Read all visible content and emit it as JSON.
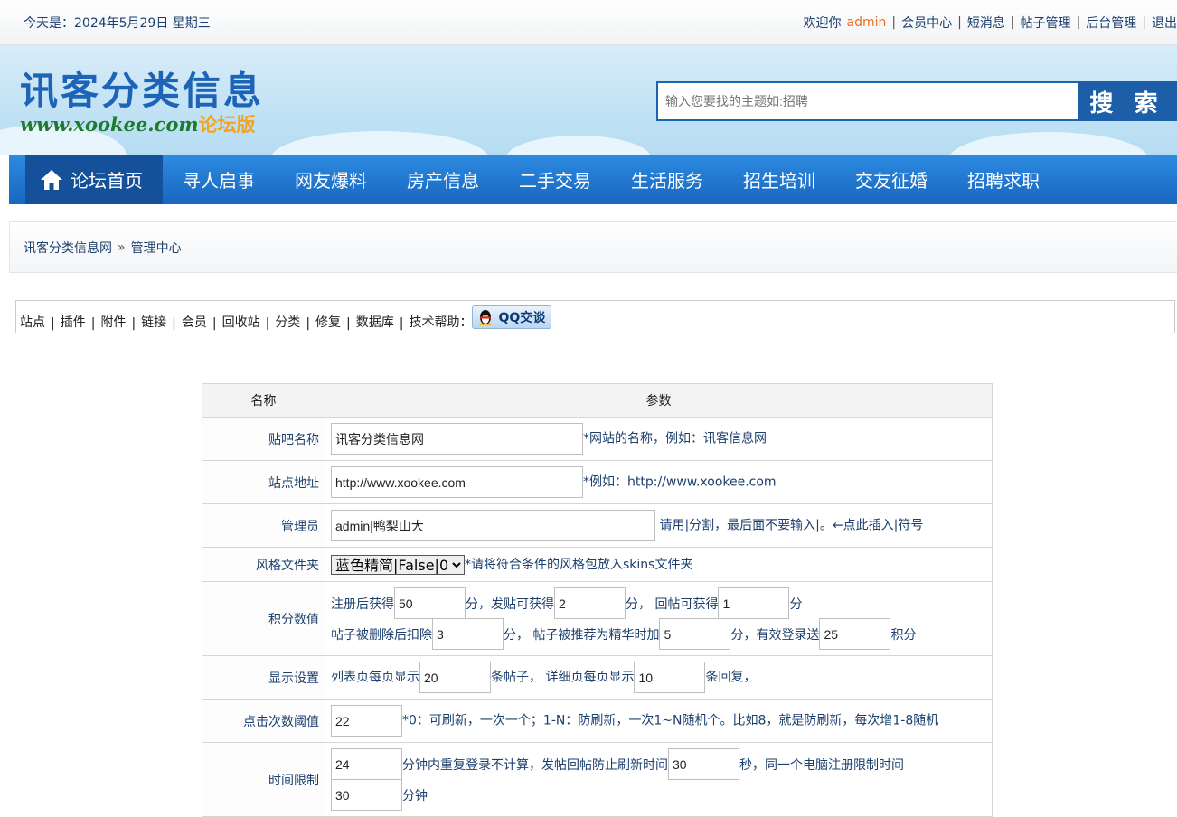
{
  "topbar": {
    "date_text": "今天是：2024年5月29日 星期三",
    "welcome": "欢迎你",
    "username": "admin",
    "links": [
      "会员中心",
      "短消息",
      "帖子管理",
      "后台管理",
      "退出"
    ]
  },
  "header": {
    "logo_cn": "讯客分类信息",
    "logo_en": "www.xookee.com",
    "logo_version": "论坛版",
    "search_placeholder": "输入您要找的主题如:招聘",
    "search_button": "搜 索"
  },
  "nav": {
    "items": [
      "论坛首页",
      "寻人启事",
      "网友爆料",
      "房产信息",
      "二手交易",
      "生活服务",
      "招生培训",
      "交友征婚",
      "招聘求职"
    ]
  },
  "breadcrumb": {
    "home": "讯客分类信息网",
    "arrow": "»",
    "current": "管理中心"
  },
  "admin_menu": {
    "items": [
      "站点",
      "插件",
      "附件",
      "链接",
      "会员",
      "回收站",
      "分类",
      "修复",
      "数据库"
    ],
    "help": "技术帮助：",
    "qq_label": "QQ交谈"
  },
  "form": {
    "col_name": "名称",
    "col_param": "参数",
    "site_name": {
      "label": "贴吧名称",
      "value": "讯客分类信息网",
      "hint": "*网站的名称，例如：讯客信息网"
    },
    "site_url": {
      "label": "站点地址",
      "value": "http://www.xookee.com",
      "hint": "*例如：http://www.xookee.com"
    },
    "admins": {
      "label": "管理员",
      "value": "admin|鸭梨山大",
      "hint": "请用|分割，最后面不要输入|。←点此插入|符号"
    },
    "skin": {
      "label": "风格文件夹",
      "selected": "蓝色精简|False|0",
      "hint": "*请将符合条件的风格包放入skins文件夹"
    },
    "points": {
      "label": "积分数值",
      "t1": "注册后获得",
      "v1": "50",
      "t2": "分，发贴可获得",
      "v2": "2",
      "t3": "分， 回帖可获得",
      "v3": "1",
      "t4": "分",
      "t5": "帖子被删除后扣除",
      "v4": "3",
      "t6": "分， 帖子被推荐为精华时加",
      "v5": "5",
      "t7": "分，有效登录送",
      "v6": "25",
      "t8": "积分"
    },
    "display": {
      "label": "显示设置",
      "t1": "列表页每页显示",
      "v1": "20",
      "t2": "条帖子， 详细页每页显示",
      "v2": "10",
      "t3": "条回复，"
    },
    "click": {
      "label": "点击次数阈值",
      "value": "22",
      "hint": "*0：可刷新，一次一个；1-N：防刷新，一次1~N随机个。比如8，就是防刷新，每次增1-8随机"
    },
    "time": {
      "label": "时间限制",
      "v1": "24",
      "t1": "分钟内重复登录不计算，发帖回帖防止刷新时间",
      "v2": "30",
      "t2": "秒，同一个电脑注册限制时间",
      "v3": "30",
      "t3": "分钟"
    }
  }
}
